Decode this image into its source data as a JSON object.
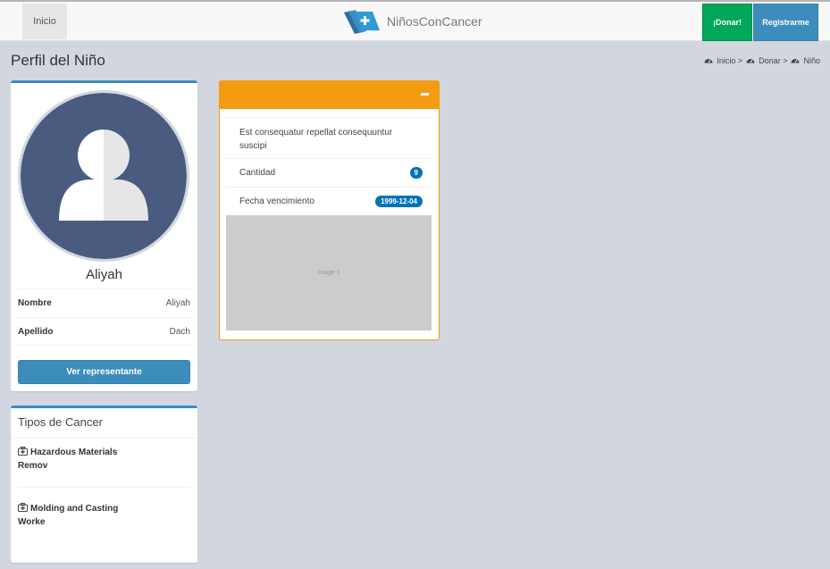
{
  "nav": {
    "home_label": "Inicio",
    "brand_name": "NiñosConCancer",
    "donate_label": "¡Donar!",
    "register_label": "Registrarme"
  },
  "header": {
    "title": "Perfil del Niño",
    "breadcrumb": [
      "Inicio >",
      "Donar >",
      "Niño"
    ]
  },
  "profile": {
    "name": "Aliyah",
    "fields": [
      {
        "label": "Nombre",
        "value": "Aliyah"
      },
      {
        "label": "Apellido",
        "value": "Dach"
      }
    ],
    "button_label": "Ver representante"
  },
  "cancer_types": {
    "title": "Tipos de Cancer",
    "items": [
      "Hazardous Materials Remov",
      "Molding and Casting Worke"
    ]
  },
  "need_card": {
    "description": "Est consequatur repellat consequuntur suscipi",
    "quantity_label": "Cantidad",
    "quantity_value": "9",
    "expiry_label": "Fecha vencimiento",
    "expiry_value": "1999-12-04",
    "image_label": "Image 1"
  },
  "colors": {
    "primary": "#3c8dbc",
    "success": "#00a65a",
    "warning": "#f39c12",
    "badge": "#0073b7",
    "avatar_bg": "#4a5b80"
  },
  "icons": {
    "breadcrumb": "dashboard-icon",
    "cancer_type": "medkit-icon",
    "card_tool": "minus-icon"
  }
}
